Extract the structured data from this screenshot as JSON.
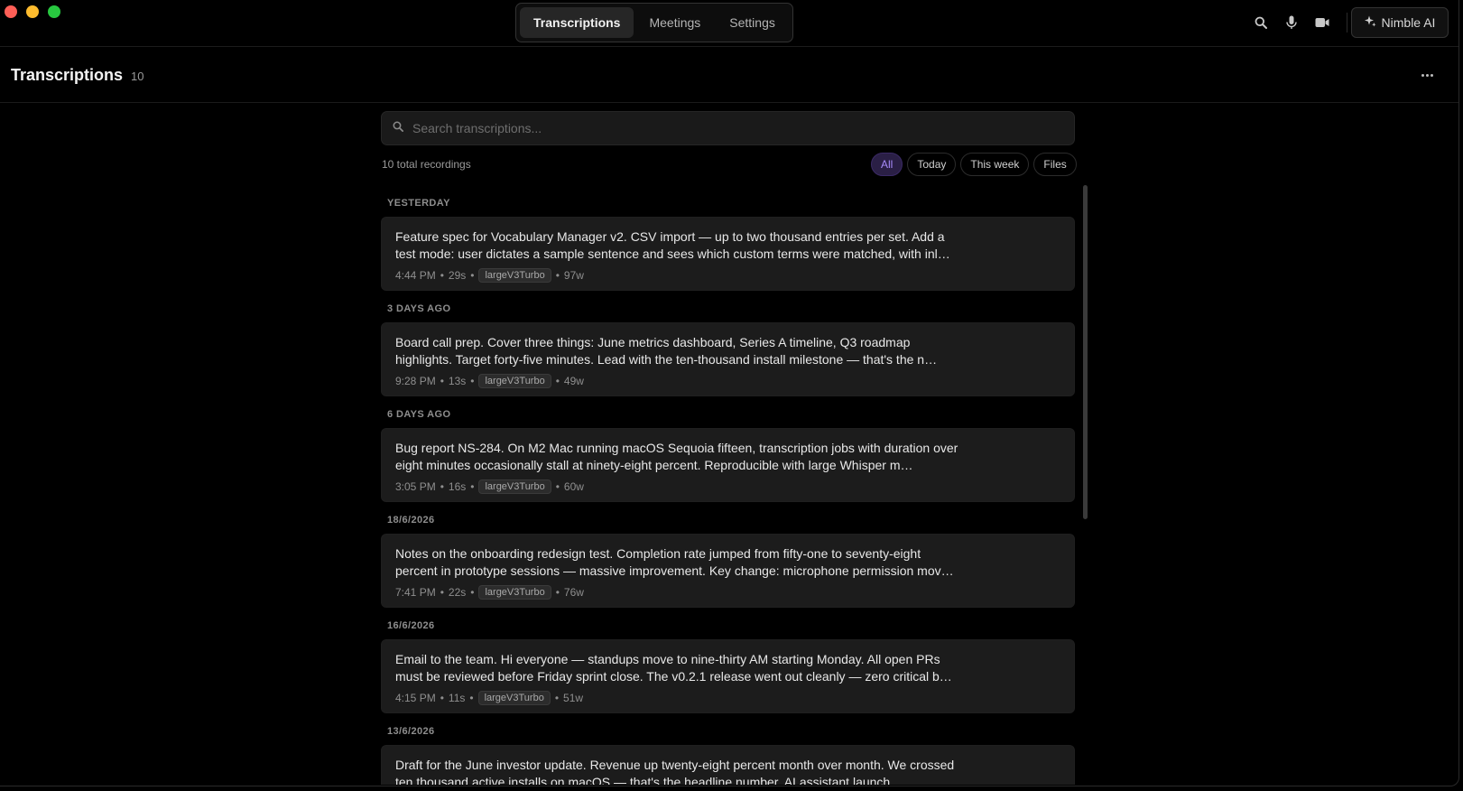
{
  "nav": {
    "tabs": [
      {
        "label": "Transcriptions"
      },
      {
        "label": "Meetings"
      },
      {
        "label": "Settings"
      }
    ],
    "ai_label": "Nimble AI"
  },
  "header": {
    "title": "Transcriptions",
    "count": "10"
  },
  "search": {
    "placeholder": "Search transcriptions..."
  },
  "summary": {
    "total": "10 total recordings"
  },
  "filters": [
    {
      "label": "All"
    },
    {
      "label": "Today"
    },
    {
      "label": "This week"
    },
    {
      "label": "Files"
    }
  ],
  "groups": [
    {
      "label": "YESTERDAY",
      "item": {
        "text": "Feature spec for Vocabulary Manager v2. CSV import — up to two thousand entries per set. Add a test mode: user dictates a sample sentence and sees which custom terms were matched, with inl…",
        "time": "4:44 PM",
        "duration": "29s",
        "model": "largeV3Turbo",
        "words": "97w"
      }
    },
    {
      "label": "3 DAYS AGO",
      "item": {
        "text": "Board call prep. Cover three things: June metrics dashboard, Series A timeline, Q3 roadmap highlights. Target forty-five minutes. Lead with the ten-thousand install milestone — that's the n…",
        "time": "9:28 PM",
        "duration": "13s",
        "model": "largeV3Turbo",
        "words": "49w"
      }
    },
    {
      "label": "6 DAYS AGO",
      "item": {
        "text": "Bug report NS-284. On M2 Mac running macOS Sequoia fifteen, transcription jobs with duration over eight minutes occasionally stall at ninety-eight percent. Reproducible with large Whisper m…",
        "time": "3:05 PM",
        "duration": "16s",
        "model": "largeV3Turbo",
        "words": "60w"
      }
    },
    {
      "label": "18/6/2026",
      "item": {
        "text": "Notes on the onboarding redesign test. Completion rate jumped from fifty-one to seventy-eight percent in prototype sessions — massive improvement. Key change: microphone permission mov…",
        "time": "7:41 PM",
        "duration": "22s",
        "model": "largeV3Turbo",
        "words": "76w"
      }
    },
    {
      "label": "16/6/2026",
      "item": {
        "text": "Email to the team. Hi everyone — standups move to nine-thirty AM starting Monday. All open PRs must be reviewed before Friday sprint close. The v0.2.1 release went out cleanly — zero critical b…",
        "time": "4:15 PM",
        "duration": "11s",
        "model": "largeV3Turbo",
        "words": "51w"
      }
    },
    {
      "label": "13/6/2026",
      "item": {
        "text": "Draft for the June investor update. Revenue up twenty-eight percent month over month. We crossed ten thousand active installs on macOS — that's the headline number. AI assistant launch…",
        "time": "",
        "duration": "",
        "model": "",
        "words": ""
      }
    }
  ],
  "meta_separator": "•",
  "colors": {
    "accent": "#a78bfa",
    "card_bg": "#1c1c1c",
    "window_bg": "#000000"
  }
}
